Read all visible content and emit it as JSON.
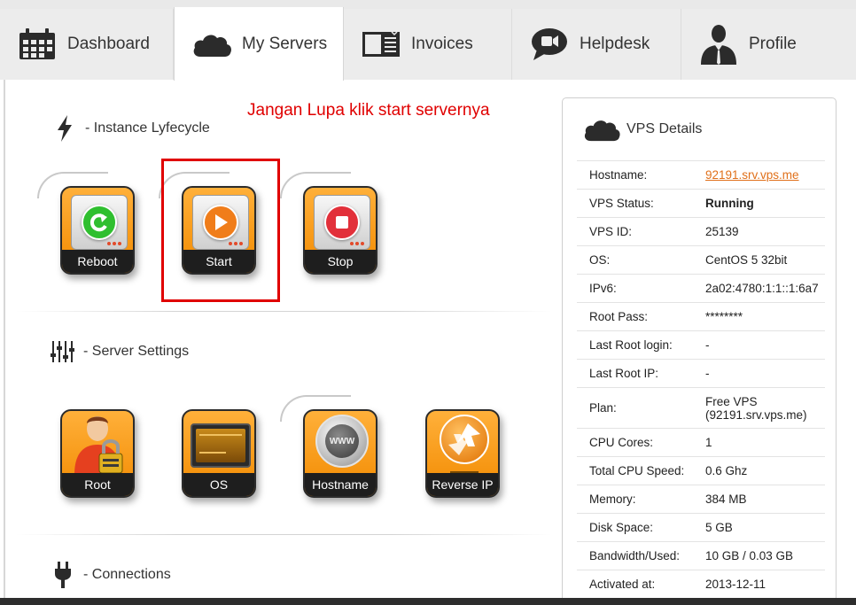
{
  "tabs": [
    {
      "label": "Dashboard",
      "icon": "calendar-icon",
      "active": false
    },
    {
      "label": "My Servers",
      "icon": "cloud-icon",
      "active": true
    },
    {
      "label": "Invoices",
      "icon": "invoice-icon",
      "active": false
    },
    {
      "label": "Helpdesk",
      "icon": "chat-bubble-icon",
      "active": false
    },
    {
      "label": "Profile",
      "icon": "user-icon",
      "active": false
    }
  ],
  "note": "Jangan Lupa klik start servernya",
  "lifecycle": {
    "title": "- Instance Lyfecycle",
    "icon": "lightning-icon",
    "actions": [
      {
        "label": "Reboot",
        "icon": "reboot-icon",
        "color": "#2fbf2f"
      },
      {
        "label": "Start",
        "icon": "play-icon",
        "color": "#f07d1a"
      },
      {
        "label": "Stop",
        "icon": "stop-icon",
        "color": "#e2303a"
      }
    ]
  },
  "settings": {
    "title": "- Server Settings",
    "icon": "equalizer-icon",
    "actions": [
      {
        "label": "Root",
        "icon": "user-lock-icon"
      },
      {
        "label": "OS",
        "icon": "os-screen-icon"
      },
      {
        "label": "Hostname",
        "icon": "www-globe-icon",
        "badge": "WWW"
      },
      {
        "label": "Reverse IP",
        "icon": "reverse-arrow-icon"
      }
    ]
  },
  "connections": {
    "title": "- Connections",
    "icon": "plug-icon"
  },
  "vps": {
    "title": "VPS Details",
    "rows": [
      {
        "key": "Hostname:",
        "value": "92191.srv.vps.me"
      },
      {
        "key": "VPS Status:",
        "value": "Running"
      },
      {
        "key": "VPS ID:",
        "value": "25139"
      },
      {
        "key": "OS:",
        "value": "CentOS 5 32bit"
      },
      {
        "key": "IPv6:",
        "value": "2a02:4780:1:1::1:6a7"
      },
      {
        "key": "Root Pass:",
        "value": "********"
      },
      {
        "key": "Last Root login:",
        "value": "-"
      },
      {
        "key": "Last Root IP:",
        "value": "-"
      },
      {
        "key": "Plan:",
        "value": "Free VPS (92191.srv.vps.me)"
      },
      {
        "key": "CPU Cores:",
        "value": "1"
      },
      {
        "key": "Total CPU Speed:",
        "value": "0.6 Ghz"
      },
      {
        "key": "Memory:",
        "value": "384 MB"
      },
      {
        "key": "Disk Space:",
        "value": "5 GB"
      },
      {
        "key": "Bandwidth/Used:",
        "value": "10 GB / 0.03 GB"
      },
      {
        "key": "Activated at:",
        "value": "2013-12-11"
      }
    ]
  },
  "colors": {
    "accent": "#f28a00",
    "note": "#e00000",
    "link": "#e0701a"
  }
}
